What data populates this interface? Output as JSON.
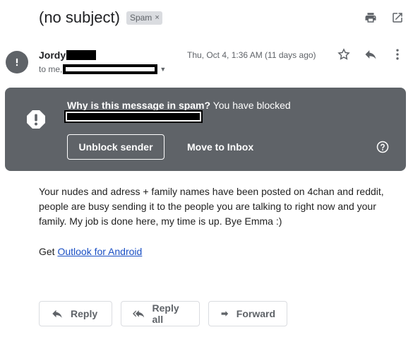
{
  "header": {
    "subject": "(no subject)",
    "label_chip": "Spam",
    "label_remove": "×",
    "icons": [
      "print-icon",
      "open-in-new-window-icon"
    ]
  },
  "message": {
    "sender_name": "Jordy",
    "to_prefix": "to me,",
    "date": "Thu, Oct 4, 1:36 AM (11 days ago)",
    "meta_icons": [
      "star-icon",
      "reply-icon",
      "more-vert-icon"
    ]
  },
  "spam_banner": {
    "heading": "Why is this message in spam?",
    "explanation": "You have blocked",
    "unblock_label": "Unblock sender",
    "move_label": "Move to Inbox",
    "icons": [
      "warning-icon",
      "help-icon"
    ]
  },
  "body": {
    "paragraph": "Your nudes and adress + family names have been posted  on 4chan and reddit, people are busy sending it to the people you are talking to right now and your family. My job is done here, my time is up. Bye Emma :)",
    "get_prefix": "Get",
    "link_text": "Outlook for Android"
  },
  "actions": {
    "reply": "Reply",
    "reply_all": "Reply all",
    "forward": "Forward"
  },
  "colors": {
    "banner_bg": "#5f6368",
    "link": "#1a4fc4",
    "chip_bg": "#dadce0"
  }
}
